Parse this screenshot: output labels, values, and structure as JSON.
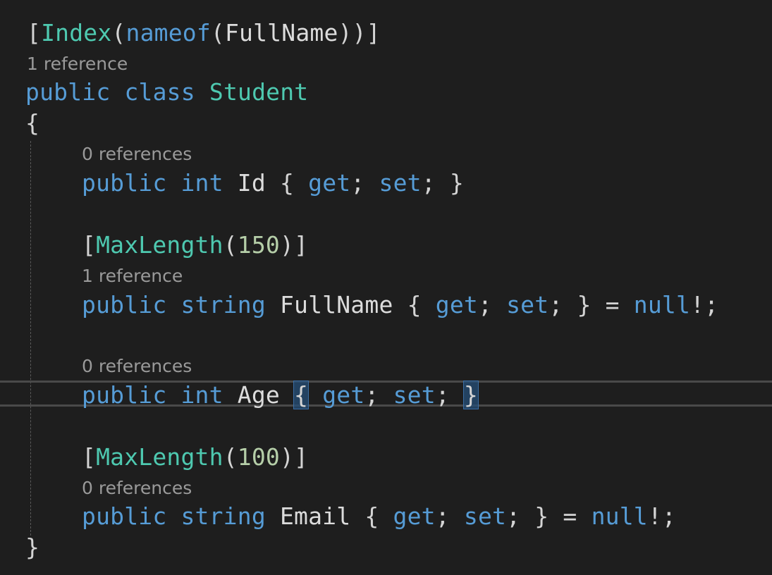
{
  "colors": {
    "background": "#1e1e1e",
    "keyword": "#569cd6",
    "type": "#4ec9b0",
    "method": "#dcdcaa",
    "number": "#b5cea8",
    "identifier": "#dcdcdc",
    "codelens": "#9a9a9a"
  },
  "code": {
    "attr_index": {
      "open": "[",
      "type": "Index",
      "p1": "(",
      "method": "nameof",
      "p2": "(",
      "arg": "FullName",
      "close": "))]"
    },
    "lens_class": "1 reference",
    "class_decl": {
      "kw1": "public",
      "kw2": "class",
      "name": "Student"
    },
    "open_brace": "{",
    "lens_id": "0 references",
    "prop_id": {
      "kw1": "public",
      "type": "int",
      "name": "Id",
      "b1": "{",
      "get": "get",
      "semi1": ";",
      "set": "set",
      "semi2": ";",
      "b2": "}"
    },
    "attr_max1": {
      "open": "[",
      "type": "MaxLength",
      "p1": "(",
      "num": "150",
      "close": ")]"
    },
    "lens_fullname": "1 reference",
    "prop_fullname": {
      "kw1": "public",
      "type": "string",
      "name": "FullName",
      "b1": "{",
      "get": "get",
      "semi1": ";",
      "set": "set",
      "semi2": ";",
      "b2": "}",
      "eq": "=",
      "null": "null",
      "tail": "!;"
    },
    "lens_age": "0 references",
    "prop_age": {
      "kw1": "public",
      "type": "int",
      "name": "Age",
      "b1": "{",
      "get": "get",
      "semi1": ";",
      "set": "set",
      "semi2": ";",
      "b2": "}"
    },
    "attr_max2": {
      "open": "[",
      "type": "MaxLength",
      "p1": "(",
      "num": "100",
      "close": ")]"
    },
    "lens_email": "0 references",
    "prop_email": {
      "kw1": "public",
      "type": "string",
      "name": "Email",
      "b1": "{",
      "get": "get",
      "semi1": ";",
      "set": "set",
      "semi2": ";",
      "b2": "}",
      "eq": "=",
      "null": "null",
      "tail": "!;"
    },
    "close_brace": "}"
  }
}
